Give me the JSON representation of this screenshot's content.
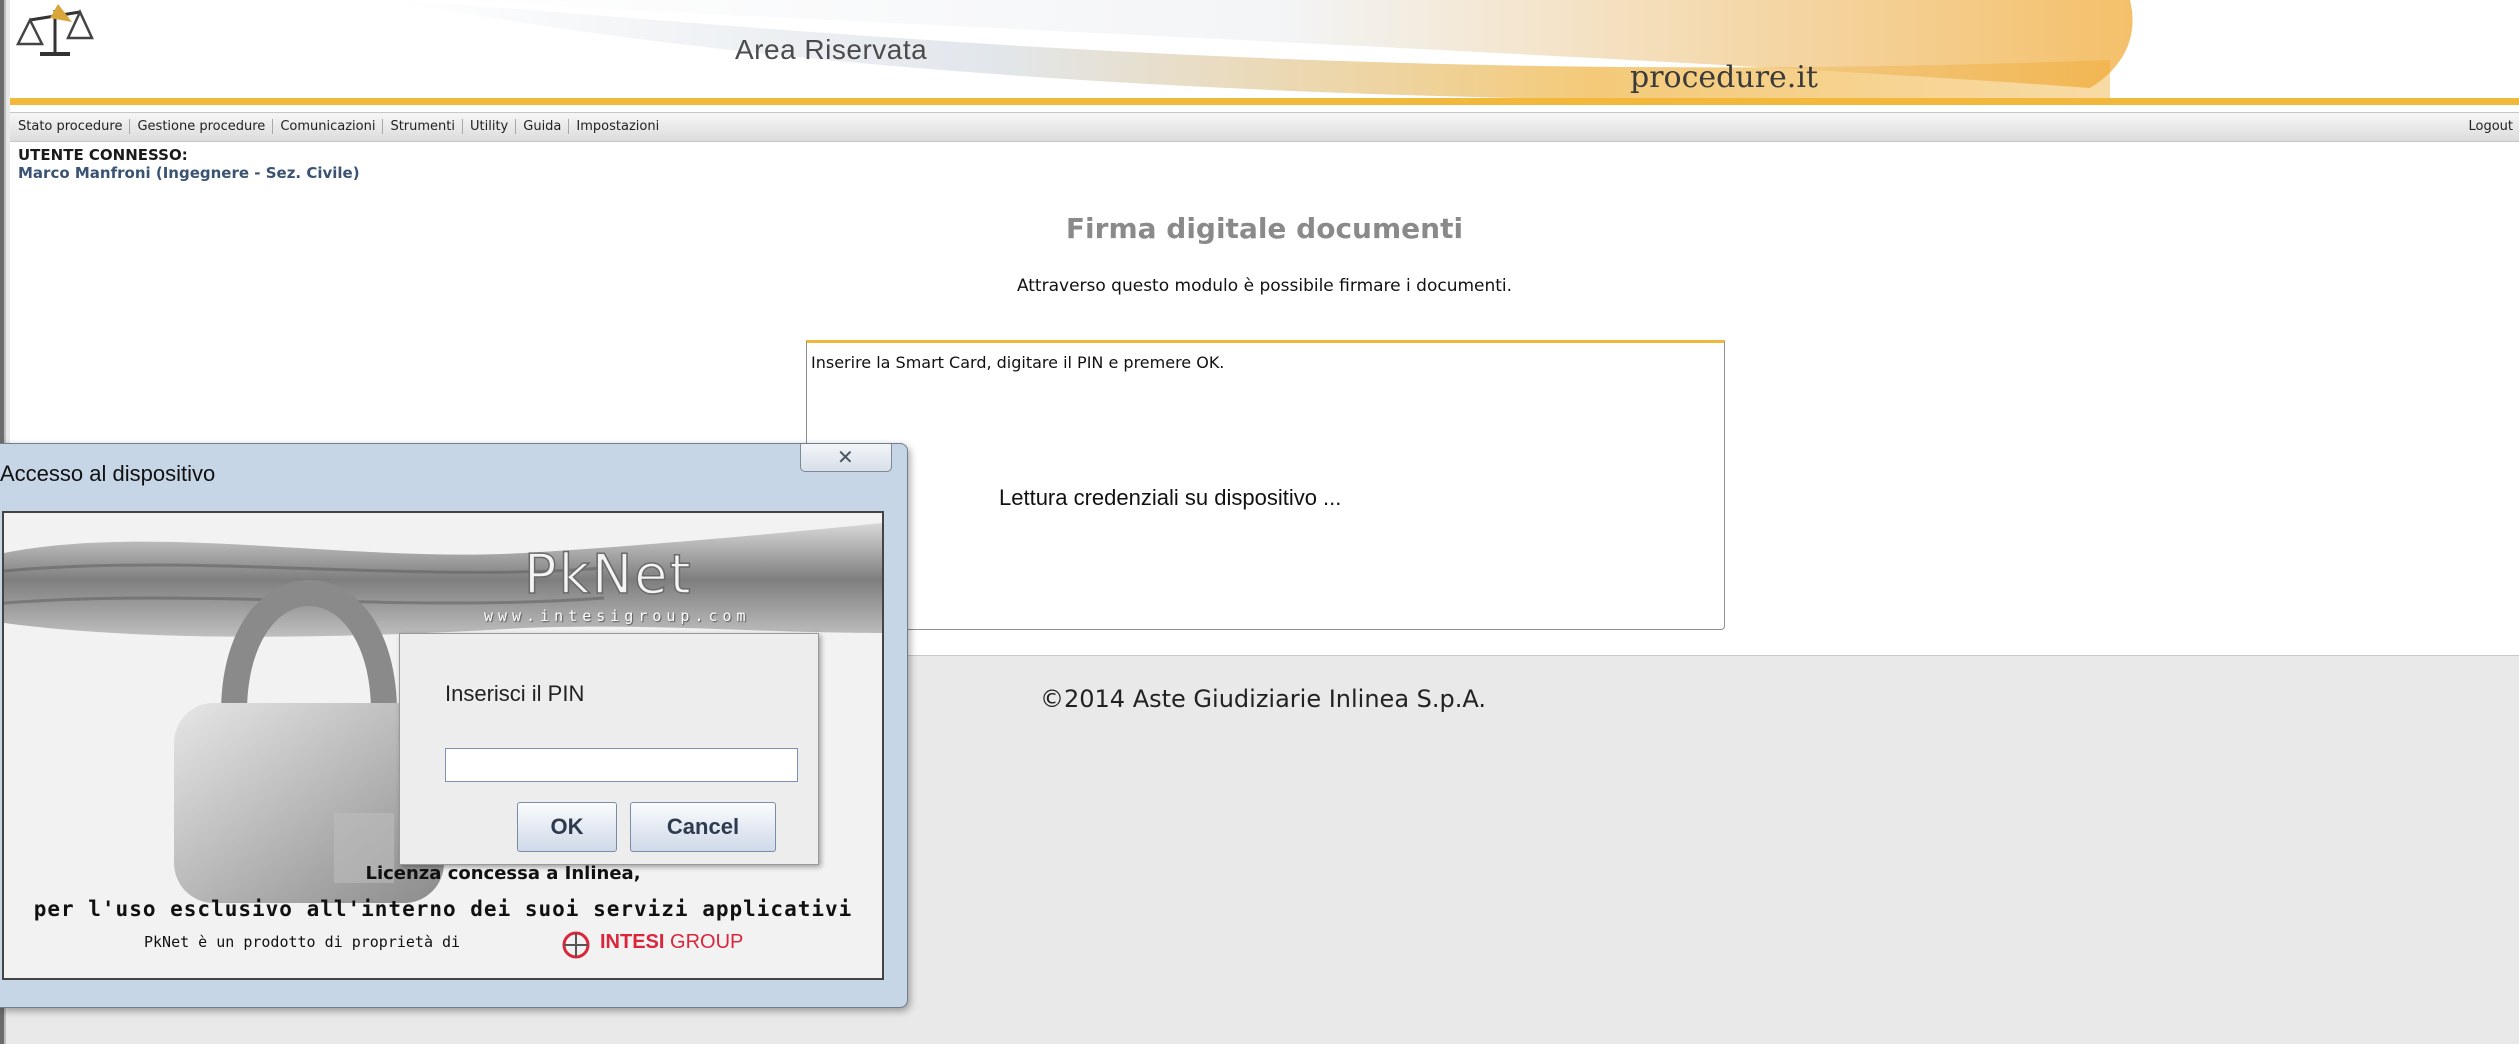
{
  "header": {
    "title": "Area Riservata",
    "logo_text": "procedure.it"
  },
  "nav": {
    "items": [
      "Stato procedure",
      "Gestione procedure",
      "Comunicazioni",
      "Strumenti",
      "Utility",
      "Guida",
      "Impostazioni"
    ],
    "logout": "Logout"
  },
  "user": {
    "label": "UTENTE CONNESSO:",
    "name": "Marco Manfroni (Ingegnere - Sez. Civile)"
  },
  "main": {
    "title": "Firma digitale documenti",
    "subtitle": "Attraverso questo modulo è possibile firmare i documenti.",
    "instruction": "Inserire la Smart Card, digitare il PIN e premere OK.",
    "status": "Lettura credenziali su dispositivo ..."
  },
  "footer": {
    "copyright": "©2014 Aste Giudiziarie Inlinea S.p.A."
  },
  "dialog": {
    "title": "Accesso al dispositivo",
    "brand": "PkNet",
    "brand_url": "www.intesigroup.com",
    "pin_label": "Inserisci il PIN",
    "pin_value": "",
    "ok_label": "OK",
    "cancel_label": "Cancel",
    "license_line1": "Licenza concessa a Inlinea,",
    "license_line2": "per l'uso esclusivo all'interno dei suoi servizi applicativi",
    "license_line3": "PkNet è un prodotto di proprietà di",
    "vendor_bold": "INTESI",
    "vendor_rest": "GROUP"
  },
  "colors": {
    "accent_orange": "#f1b83c",
    "user_name": "#3a5373",
    "title_gray": "#8a8a8a",
    "intesi_red": "#d9263b"
  }
}
